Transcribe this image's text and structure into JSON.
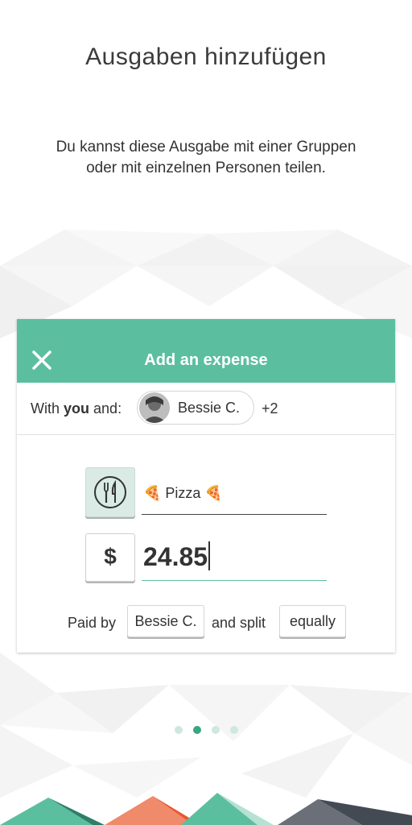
{
  "page": {
    "title": "Ausgaben hinzufügen",
    "subtitle_line1": "Du kannst diese Ausgabe mit einer Gruppen",
    "subtitle_line2": "oder mit einzelnen Personen teilen."
  },
  "card": {
    "header_title": "Add an expense",
    "close_icon": "close-icon",
    "with_prefix": "With ",
    "with_you": "you",
    "with_suffix": " and:",
    "participant_name": "Bessie C.",
    "more_count": "+2",
    "category_icon": "fork-knife-icon",
    "description": "🍕 Pizza 🍕",
    "currency_symbol": "$",
    "amount": "24.85",
    "paid_by_label": "Paid by",
    "payer": "Bessie C.",
    "split_label": "and split",
    "split_method": "equally"
  },
  "pagination": {
    "pages": 4,
    "active_index": 1
  },
  "colors": {
    "accent": "#5bbf9f",
    "dot_inactive": "#cfe8df",
    "dot_active": "#3aa583",
    "mountain_green_dark": "#2f7e67",
    "mountain_green_light": "#b5e2d2",
    "mountain_orange": "#e9572f",
    "mountain_gray": "#444a54"
  }
}
